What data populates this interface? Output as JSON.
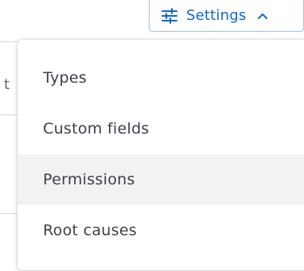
{
  "background": {
    "partial_letter": "t"
  },
  "header": {
    "settings_button": {
      "label": "Settings",
      "icon": "sliders-icon",
      "chevron": "chevron-up-icon",
      "accent_color": "#0d66d0"
    }
  },
  "menu": {
    "items": [
      {
        "label": "Types",
        "highlighted": false
      },
      {
        "label": "Custom fields",
        "highlighted": false
      },
      {
        "label": "Permissions",
        "highlighted": true
      },
      {
        "label": "Root causes",
        "highlighted": false
      }
    ],
    "highlight_color": "#f2f2f2"
  }
}
